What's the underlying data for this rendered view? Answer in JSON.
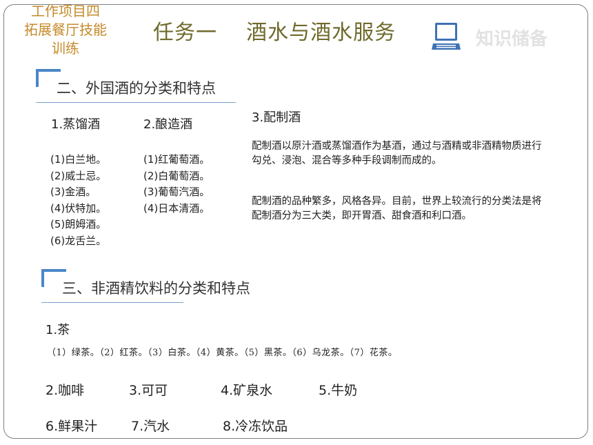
{
  "header": {
    "project_line1": "工作项目四",
    "project_line2": "拓展餐厅技能",
    "project_line3": "训练",
    "task_title": "任务一    酒水与酒水服务",
    "laptop_icon": "laptop-icon",
    "knowledge_label": "知识储备"
  },
  "section2": {
    "heading": "二、外国酒的分类和特点",
    "distilled": {
      "title": "1.蒸馏酒",
      "items": [
        "(1)白兰地。",
        "(2)威士忌。",
        "(3)金酒。",
        "(4)伏特加。",
        "(5)朗姆酒。",
        "(6)龙舌兰。"
      ]
    },
    "brewed": {
      "title": "2.酿造酒",
      "items": [
        "(1)红葡萄酒。",
        "(2)白葡萄酒。",
        "(3)葡萄汽酒。",
        "(4)日本清酒。"
      ]
    },
    "mixed": {
      "title": "3.配制酒",
      "para1": "配制酒以原汁酒或蒸馏酒作为基酒，通过与酒精或非酒精物质进行勾兑、浸泡、混合等多种手段调制而成的。",
      "para2": "配制酒的品种繁多，风格各异。目前，世界上较流行的分类法是将配制酒分为三大类，即开胃酒、甜食酒和利口酒。"
    }
  },
  "section3": {
    "heading": "三、非酒精饮料的分类和特点",
    "tea_title": "1.茶",
    "tea_types": "（1）绿茶。（2）红茶。（3）白茶。（4）黄茶。（5）黑茶。（6）乌龙茶。（7）花茶。",
    "items_row1": [
      "2.咖啡",
      "3.可可",
      "4.矿泉水",
      "5.牛奶"
    ],
    "items_row2": [
      "6.鲜果汁",
      "7.汽水",
      "8.冷冻饮品"
    ]
  },
  "colors": {
    "project_text": "#c58a2a",
    "task_text": "#6f6a2c",
    "accent_blue": "#4a86c8",
    "knowledge_text": "#e2e2e2"
  }
}
